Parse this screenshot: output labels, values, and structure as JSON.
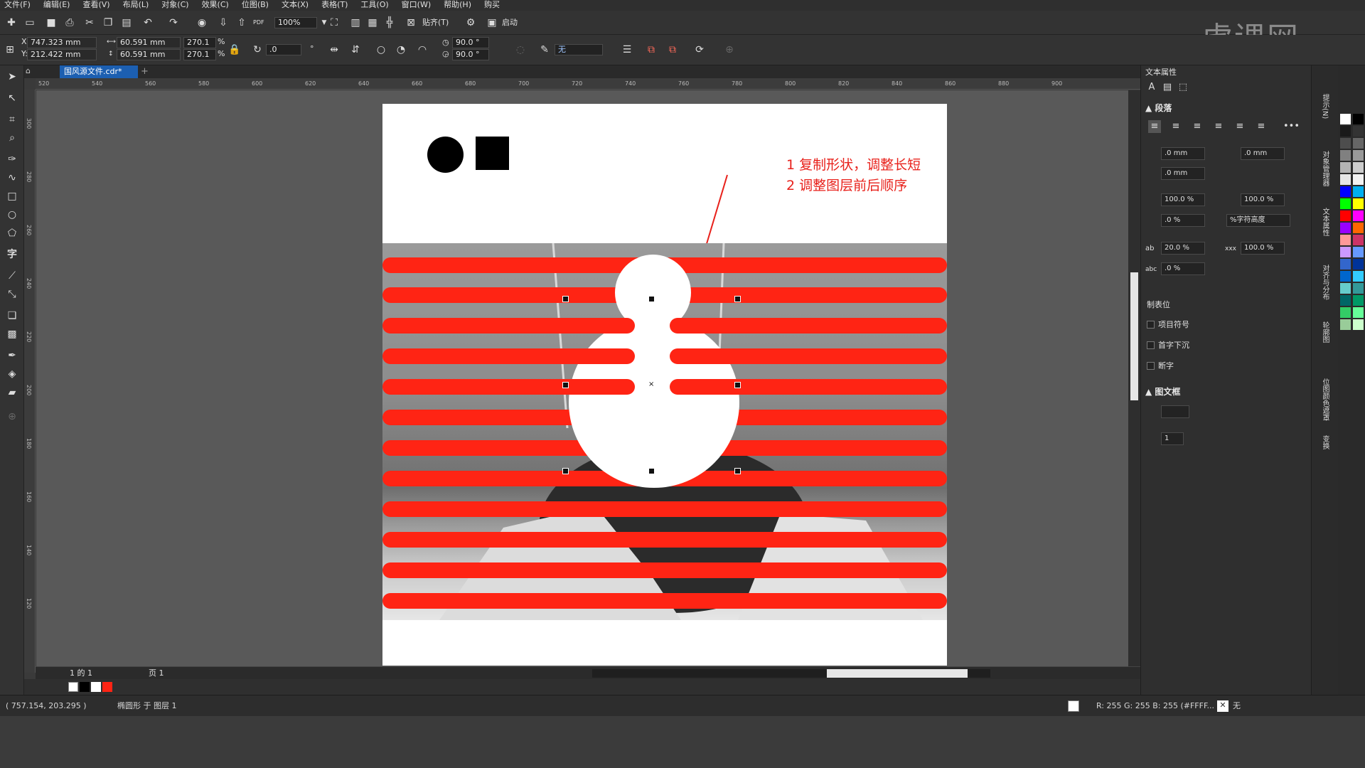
{
  "menubar": [
    "文件(F)",
    "编辑(E)",
    "查看(V)",
    "布局(L)",
    "对象(C)",
    "效果(C)",
    "位图(B)",
    "文本(X)",
    "表格(T)",
    "工具(O)",
    "窗口(W)",
    "帮助(H)",
    "购买"
  ],
  "toolbar1": {
    "zoom": "100%",
    "snap": "贴齐(T)",
    "launch": "启动",
    "pdf": "PDF"
  },
  "toolbar2": {
    "x_label": "X:",
    "x": "747.323 mm",
    "y_label": "Y:",
    "y": "212.422 mm",
    "w": "60.591 mm",
    "h": "60.591 mm",
    "sx": "270.1",
    "sy": "270.1",
    "pct": "%",
    "rotate": ".0",
    "deg": "°",
    "arc_start": "90.0 °",
    "arc_end": "90.0 °",
    "outline": "无"
  },
  "document": {
    "tab": "国风源文件.cdr*"
  },
  "ruler_h": [
    "520",
    "540",
    "560",
    "580",
    "600",
    "620",
    "640",
    "660",
    "680",
    "700",
    "720",
    "740",
    "760",
    "780",
    "800",
    "820",
    "840",
    "860",
    "880",
    "900"
  ],
  "ruler_v": [
    "300",
    "280",
    "260",
    "240",
    "220",
    "200",
    "180",
    "160",
    "140",
    "120"
  ],
  "annotation": {
    "line1": "1 复制形状，调整长短",
    "line2": "2 调整图层前后顺序"
  },
  "page_nav": {
    "count": "1 的 1",
    "page": "页 1"
  },
  "status": {
    "coords": "( 757.154, 203.295 )",
    "object": "椭圆形 于 图层 1",
    "fill": "R: 255 G: 255 B: 255 (#FFFF...",
    "outline": "无"
  },
  "panel": {
    "title": "文本属性",
    "paragraph": "段落",
    "indent1": ".0 mm",
    "indent2": ".0 mm",
    "indent3": ".0 mm",
    "spacing1": "100.0 %",
    "spacing2": "100.0 %",
    "spacing3": ".0 %",
    "spacing_unit": "%字符高度",
    "char_spacing": "20.0 %",
    "word_spacing": "100.0 %",
    "lang_spacing": ".0 %",
    "tabs": "制表位",
    "bullets": "项目符号",
    "dropcap": "首字下沉",
    "hyphen": "断字",
    "frame": "图文框",
    "columns": "1",
    "ab": "ab",
    "xxx": "xxx",
    "abc": "abc"
  },
  "dockers": [
    "提示(N)",
    "对象管理器",
    "文本属性",
    "对齐与分布",
    "轮廓图",
    "位图颜色遮罩",
    "变换"
  ],
  "watermark": "虎课网",
  "colors": {
    "stripe": "#ff2414",
    "accent": "#1c5fb1"
  }
}
